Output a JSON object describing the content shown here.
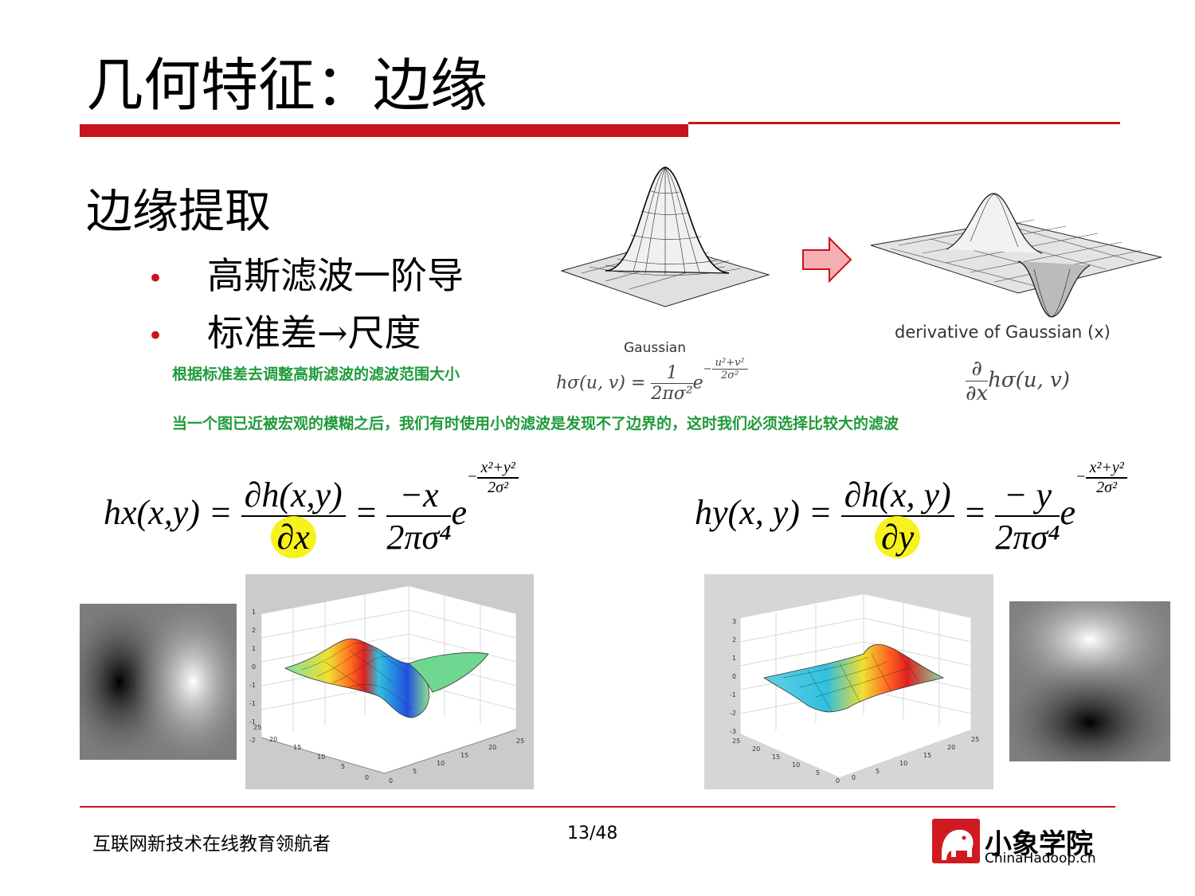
{
  "slide": {
    "title": "几何特征：边缘",
    "heading": "边缘提取",
    "bullets": [
      "高斯滤波一阶导",
      "标准差→尺度"
    ],
    "notes": [
      "根据标准差去调整高斯滤波的滤波范围大小",
      "当一个图已近被宏观的模糊之后，我们有时使用小的滤波是发现不了边界的，这时我们必须选择比较大的滤波"
    ]
  },
  "figures": {
    "gaussian_caption": "Gaussian",
    "derivative_caption": "derivative of Gaussian (x)"
  },
  "formulas": {
    "gauss": {
      "lhs": "hσ(u, v) =",
      "num": "1",
      "den": "2πσ²",
      "e": "e",
      "exp_num": "u²+v²",
      "exp_den": "2σ²"
    },
    "deriv": {
      "num": "∂",
      "den": "∂x",
      "rest": "hσ(u, v)"
    },
    "hx": {
      "lhs": "hx(x,y) =",
      "num1": "∂h(x,y)",
      "den1": "∂x",
      "eq": "=",
      "num2": "−x",
      "den2": "2πσ⁴",
      "e": "e",
      "exp_num": "x²+y²",
      "exp_den": "2σ²"
    },
    "hy": {
      "lhs": "hy(x, y) =",
      "num1": "∂h(x, y)",
      "den1": "∂y",
      "eq": "=",
      "num2": "− y",
      "den2": "2πσ⁴",
      "e": "e",
      "exp_num": "x²+y²",
      "exp_den": "2σ²"
    }
  },
  "plots": {
    "left_z_ticks": [
      "1",
      "2",
      "1",
      "0",
      "-1",
      "-1",
      "-1",
      "-2"
    ],
    "left_x_ticks": [
      "0",
      "5",
      "10",
      "15",
      "20",
      "25"
    ],
    "left_y_ticks": [
      "25",
      "20",
      "15",
      "10",
      "5",
      "0"
    ],
    "right_z_ticks": [
      "3",
      "2",
      "1",
      "0",
      "-1",
      "-2",
      "-3"
    ],
    "right_x_ticks": [
      "25",
      "20",
      "15",
      "10",
      "5",
      "0"
    ],
    "right_y_ticks": [
      "0",
      "5",
      "10",
      "15",
      "20",
      "25"
    ]
  },
  "footer": {
    "tagline": "互联网新技术在线教育领航者",
    "page": "13/48",
    "logo_name": "小象学院",
    "logo_sub": "ChinaHadoop.cn"
  },
  "colors": {
    "accent": "#c8141c",
    "note_green": "#1f9a3a",
    "highlight": "#f7f21e"
  }
}
